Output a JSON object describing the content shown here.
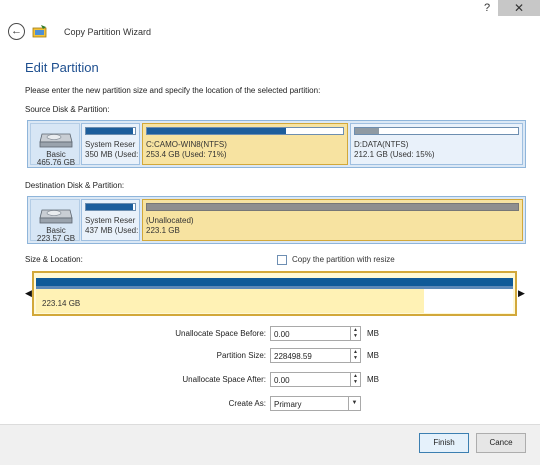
{
  "window": {
    "help_label": "?",
    "close_label": "✕"
  },
  "wizard": {
    "title": "Copy Partition Wizard",
    "back_icon": "back-arrow-icon",
    "app_icon": "wizard-wand-icon"
  },
  "page": {
    "heading": "Edit Partition",
    "instruction": "Please enter the new partition size and specify the location of the selected partition:"
  },
  "source": {
    "label": "Source Disk & Partition:",
    "disk": {
      "name": "Basic",
      "size": "465.76 GB"
    },
    "partitions": [
      {
        "line1": "System Reser",
        "line2": "350 MB (Used:",
        "used_fraction": 0.95
      },
      {
        "line1": "C:CAMO-WIN8(NTFS)",
        "line2": "253.4 GB (Used: 71%)",
        "used_fraction": 0.71
      },
      {
        "line1": "D:DATA(NTFS)",
        "line2": "212.1 GB (Used: 15%)",
        "used_fraction": 0.15
      }
    ]
  },
  "destination": {
    "label": "Destination Disk & Partition:",
    "disk": {
      "name": "Basic",
      "size": "223.57 GB"
    },
    "partitions": [
      {
        "line1": "System Reser",
        "line2": "437 MB (Used:",
        "used_fraction": 0.95
      },
      {
        "line1": "(Unallocated)",
        "line2": "223.1 GB",
        "used_fraction": 0
      }
    ]
  },
  "size_location": {
    "label": "Size & Location:",
    "checkbox_label": "Copy the partition with resize",
    "checked": false,
    "partition_size_text": "223.14 GB",
    "fill_fraction": 0.81
  },
  "form": {
    "unalloc_before": {
      "label": "Unallocate Space Before:",
      "value": "0.00",
      "unit": "MB"
    },
    "partition_size": {
      "label": "Partition Size:",
      "value": "228498.59",
      "unit": "MB"
    },
    "unalloc_after": {
      "label": "Unallocate Space After:",
      "value": "0.00",
      "unit": "MB"
    },
    "create_as": {
      "label": "Create As:",
      "value": "Primary"
    }
  },
  "buttons": {
    "finish": "Finish",
    "cancel": "Cance"
  }
}
